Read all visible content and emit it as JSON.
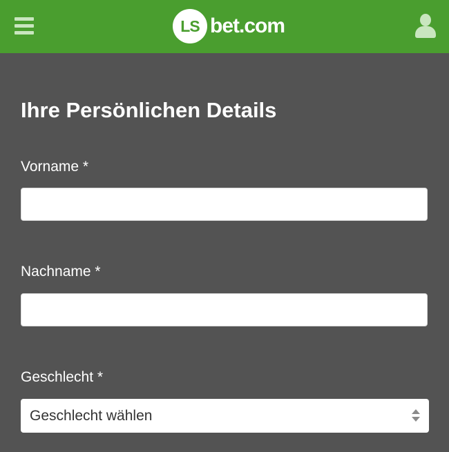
{
  "header": {
    "logo_mark": "LS",
    "logo_text": "bet.com",
    "menu_icon": "hamburger-menu-icon",
    "user_icon": "user-icon",
    "background_color": "#4a9e2f"
  },
  "form": {
    "title": "Ihre Persönlichen Details",
    "first_name": {
      "label": "Vorname *",
      "value": "",
      "placeholder": ""
    },
    "last_name": {
      "label": "Nachname *",
      "value": "",
      "placeholder": ""
    },
    "gender": {
      "label": "Geschlecht *",
      "selected": "Geschlecht wählen",
      "icon": "select-arrows-icon"
    }
  },
  "colors": {
    "page_background": "#535353",
    "brand_green": "#4a9e2f"
  }
}
